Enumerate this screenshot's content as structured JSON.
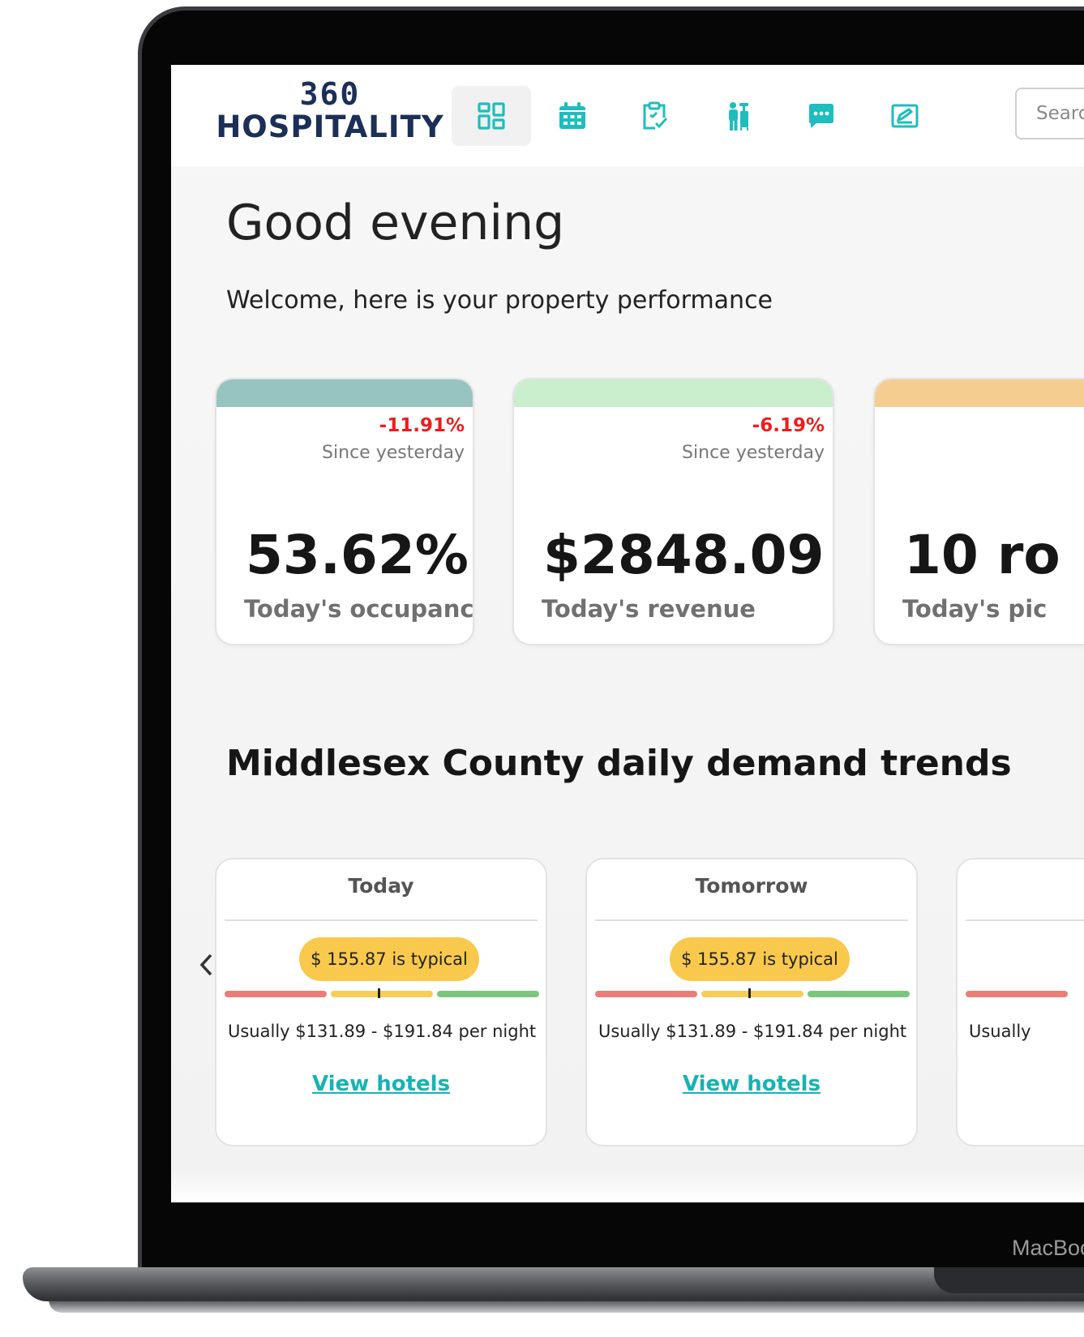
{
  "brand": {
    "number": "360",
    "name": "HOSPITALITY"
  },
  "laptop_label": "MacBook",
  "nav": [
    {
      "name": "dashboard",
      "icon": "dashboard-grid-icon",
      "active": true
    },
    {
      "name": "calendar",
      "icon": "calendar-icon",
      "active": false
    },
    {
      "name": "tasks",
      "icon": "clipboard-check-icon",
      "active": false
    },
    {
      "name": "staff",
      "icon": "bellhop-icon",
      "active": false
    },
    {
      "name": "messages",
      "icon": "chat-icon",
      "active": false
    },
    {
      "name": "reviews",
      "icon": "edit-note-icon",
      "active": false
    }
  ],
  "search": {
    "placeholder": "Search"
  },
  "greeting": "Good evening",
  "welcome": "Welcome, here is your property performance",
  "kpis": [
    {
      "delta": "-11.91%",
      "since": "Since yesterday",
      "value": "53.62%",
      "label": "Today's occupancy",
      "color": "#96c4c0"
    },
    {
      "delta": "-6.19%",
      "since": "Since yesterday",
      "value": "$2848.09",
      "label": "Today's revenue",
      "color": "#c9efcd"
    },
    {
      "delta": "",
      "since": "",
      "value": "10 ro",
      "label": "Today's pic",
      "color": "#f6cd91"
    }
  ],
  "demand": {
    "title": "Middlesex County daily demand trends",
    "cards": [
      {
        "day": "Today",
        "price": "$ 155.87 is typical",
        "range": "Usually $131.89 - $191.84 per night",
        "link": "View hotels"
      },
      {
        "day": "Tomorrow",
        "price": "$ 155.87 is typical",
        "range": "Usually $131.89 - $191.84 per night",
        "link": "View hotels"
      },
      {
        "day": "",
        "price": "",
        "range": "Usually",
        "link": ""
      }
    ]
  },
  "colors": {
    "accent": "#17b3b3",
    "brand": "#1b2f57",
    "negative": "#ee1c1c",
    "typical_pill": "#f8c94c"
  }
}
